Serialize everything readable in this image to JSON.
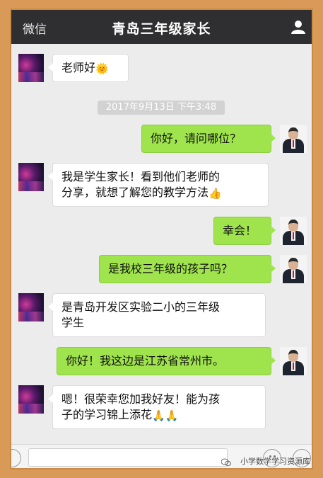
{
  "topbar": {
    "back_label": "微信",
    "title": "青岛三年级家长",
    "profile_icon": "person-icon"
  },
  "timestamp": "2017年9月13日 下午3:48",
  "messages": [
    {
      "side": "left",
      "text": "老师好",
      "emoji": "🌞"
    },
    {
      "side": "right",
      "text": "你好，请问哪位？"
    },
    {
      "side": "left",
      "line1": "我是学生家长！看到他们老师的",
      "line2": "分享，就想了解您的教学方法",
      "emoji": "👍"
    },
    {
      "side": "right",
      "text": "幸会！"
    },
    {
      "side": "right",
      "text": "是我校三年级的孩子吗？"
    },
    {
      "side": "left",
      "line1": "是青岛开发区实验二小的三年级",
      "line2": "学生"
    },
    {
      "side": "right",
      "text": "你好！我这边是江苏省常州市。"
    },
    {
      "side": "left",
      "line1": "嗯！很荣幸您加我好友！能为孩",
      "line2": "子的学习锦上添花",
      "emoji": "🙏🙏"
    }
  ],
  "watermark": "小学数学学习资源库",
  "colors": {
    "frame_border": "#d99a57",
    "topbar": "#2f2f31",
    "bubble_right": "#9fe44c",
    "bubble_left": "#ffffff",
    "chat_bg": "#ececec"
  }
}
